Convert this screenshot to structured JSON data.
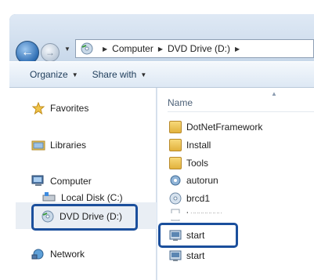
{
  "breadcrumb": {
    "items": [
      "Computer",
      "DVD Drive (D:)"
    ]
  },
  "toolbar": {
    "organize": "Organize",
    "share_with": "Share with"
  },
  "nav": {
    "favorites": "Favorites",
    "libraries": "Libraries",
    "computer": "Computer",
    "local_disk": "Local Disk (C:)",
    "dvd_drive": "DVD Drive (D:)",
    "network": "Network"
  },
  "list": {
    "column_name": "Name",
    "files": [
      {
        "name": "DotNetFramework",
        "icon": "folder-icon"
      },
      {
        "name": "Install",
        "icon": "folder-icon"
      },
      {
        "name": "Tools",
        "icon": "folder-icon"
      },
      {
        "name": "autorun",
        "icon": "setup-icon"
      },
      {
        "name": "brcd1",
        "icon": "disc-icon"
      },
      {
        "name": "Lxxxxxxxx",
        "icon": "file-icon"
      },
      {
        "name": "start",
        "icon": "app-icon"
      },
      {
        "name": "start",
        "icon": "app-icon"
      }
    ]
  },
  "colors": {
    "highlight": "#1b4f9c",
    "frame": "#d7e4f2"
  }
}
